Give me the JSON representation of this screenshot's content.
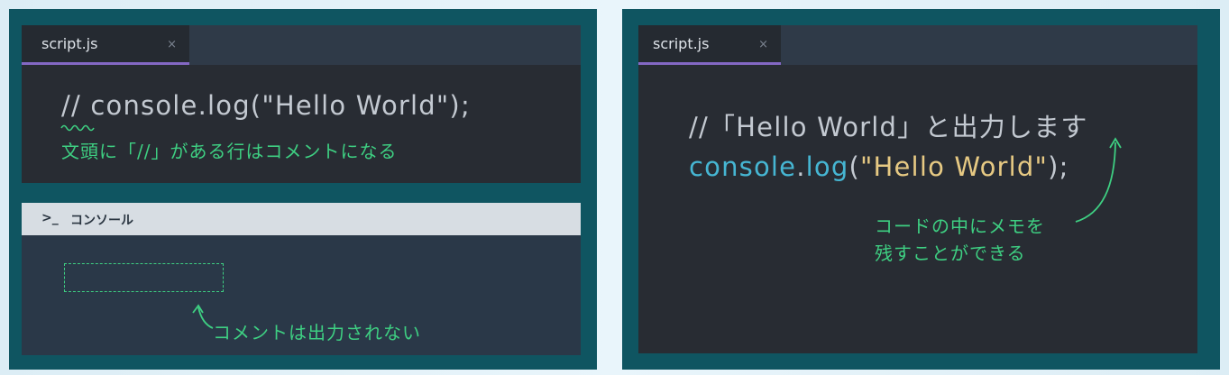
{
  "left_editor": {
    "tab_label": "script.js",
    "tab_close": "×",
    "code_line": "// console.log(\"Hello World\");",
    "note": "文頭に「//」がある行はコメントになる"
  },
  "console": {
    "prompt_icon": ">_",
    "title": "コンソール",
    "note": "コメントは出力されない"
  },
  "right_editor": {
    "tab_label": "script.js",
    "tab_close": "×",
    "comment_line": "//「Hello World」と出力します",
    "code": {
      "object": "console",
      "dot": ".",
      "method": "log",
      "open": "(",
      "string": "\"Hello World\"",
      "close": ");"
    },
    "note_line1": "コードの中にメモを",
    "note_line2": "残すことができる"
  },
  "colors": {
    "panel_bg": "#0f5561",
    "editor_bg": "#282c33",
    "tab_accent": "#8468c4",
    "annotation_green": "#3ecf82",
    "code_gray": "#c3c9d1",
    "code_cyan": "#46b6d3",
    "code_yellow": "#e6c983"
  }
}
